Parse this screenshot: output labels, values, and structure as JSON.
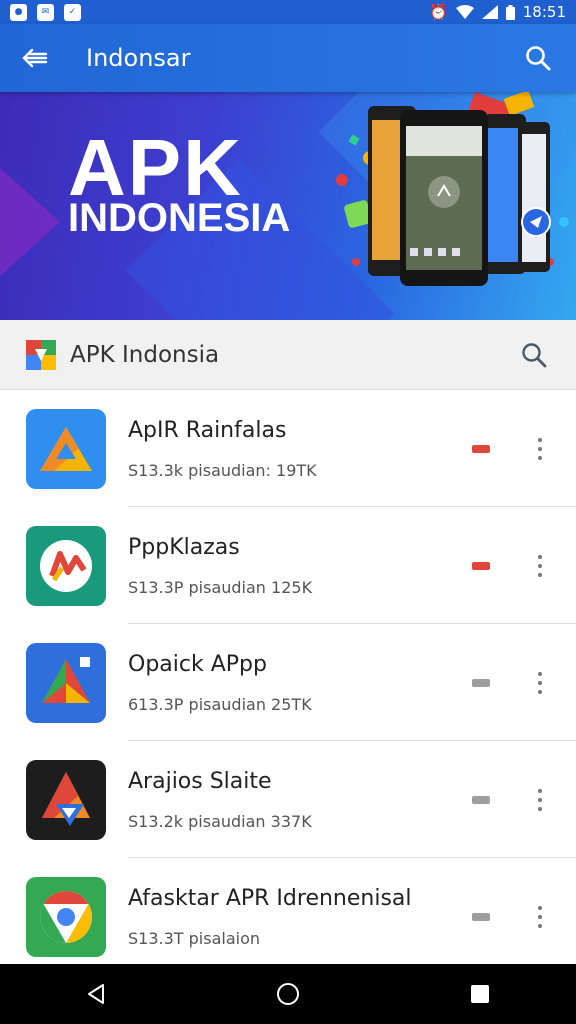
{
  "status_bar": {
    "time": "18:51",
    "left_icons": [
      "notification-icon-1",
      "notification-icon-2",
      "notification-icon-3"
    ],
    "right_icons": [
      "alarm-icon",
      "wifi-icon",
      "signal-icon",
      "battery-icon"
    ]
  },
  "app_bar": {
    "title": "Indonsar",
    "back_icon": "back-arrow-icon",
    "search_icon": "search-icon"
  },
  "banner": {
    "line1": "APK",
    "line2": "INDONESIA"
  },
  "section": {
    "title": "APK Indonsia",
    "search_icon": "search-icon"
  },
  "apps": [
    {
      "name": "ApIR Rainfalas",
      "meta": "S13.3k pisaudian: 19TK",
      "badge_color": "#e0473b",
      "icon": "triangle-app-icon"
    },
    {
      "name": "PppKlazas",
      "meta": "S13.3P pisaudian 125K",
      "badge_color": "#e0473b",
      "icon": "circle-arrow-app-icon"
    },
    {
      "name": "Opaick APpp",
      "meta": "613.3P pisaudian 25TK",
      "badge_color": "#9e9e9e",
      "icon": "multicolor-arrow-app-icon"
    },
    {
      "name": "Arajios Slaite",
      "meta": "S13.2k pisaudian 337K",
      "badge_color": "#9e9e9e",
      "icon": "flame-app-icon"
    },
    {
      "name": "Afasktar APR Idrennenisal",
      "meta": "S13.3T pisalaion",
      "badge_color": "#9e9e9e",
      "icon": "chrome-app-icon"
    }
  ],
  "nav_bar": [
    "back-triangle-icon",
    "home-circle-icon",
    "recents-square-icon"
  ],
  "colors": {
    "app_bar": "#2166d6",
    "status_bar": "#1f5fcf",
    "badge_red": "#e0473b",
    "badge_gray": "#9e9e9e"
  }
}
